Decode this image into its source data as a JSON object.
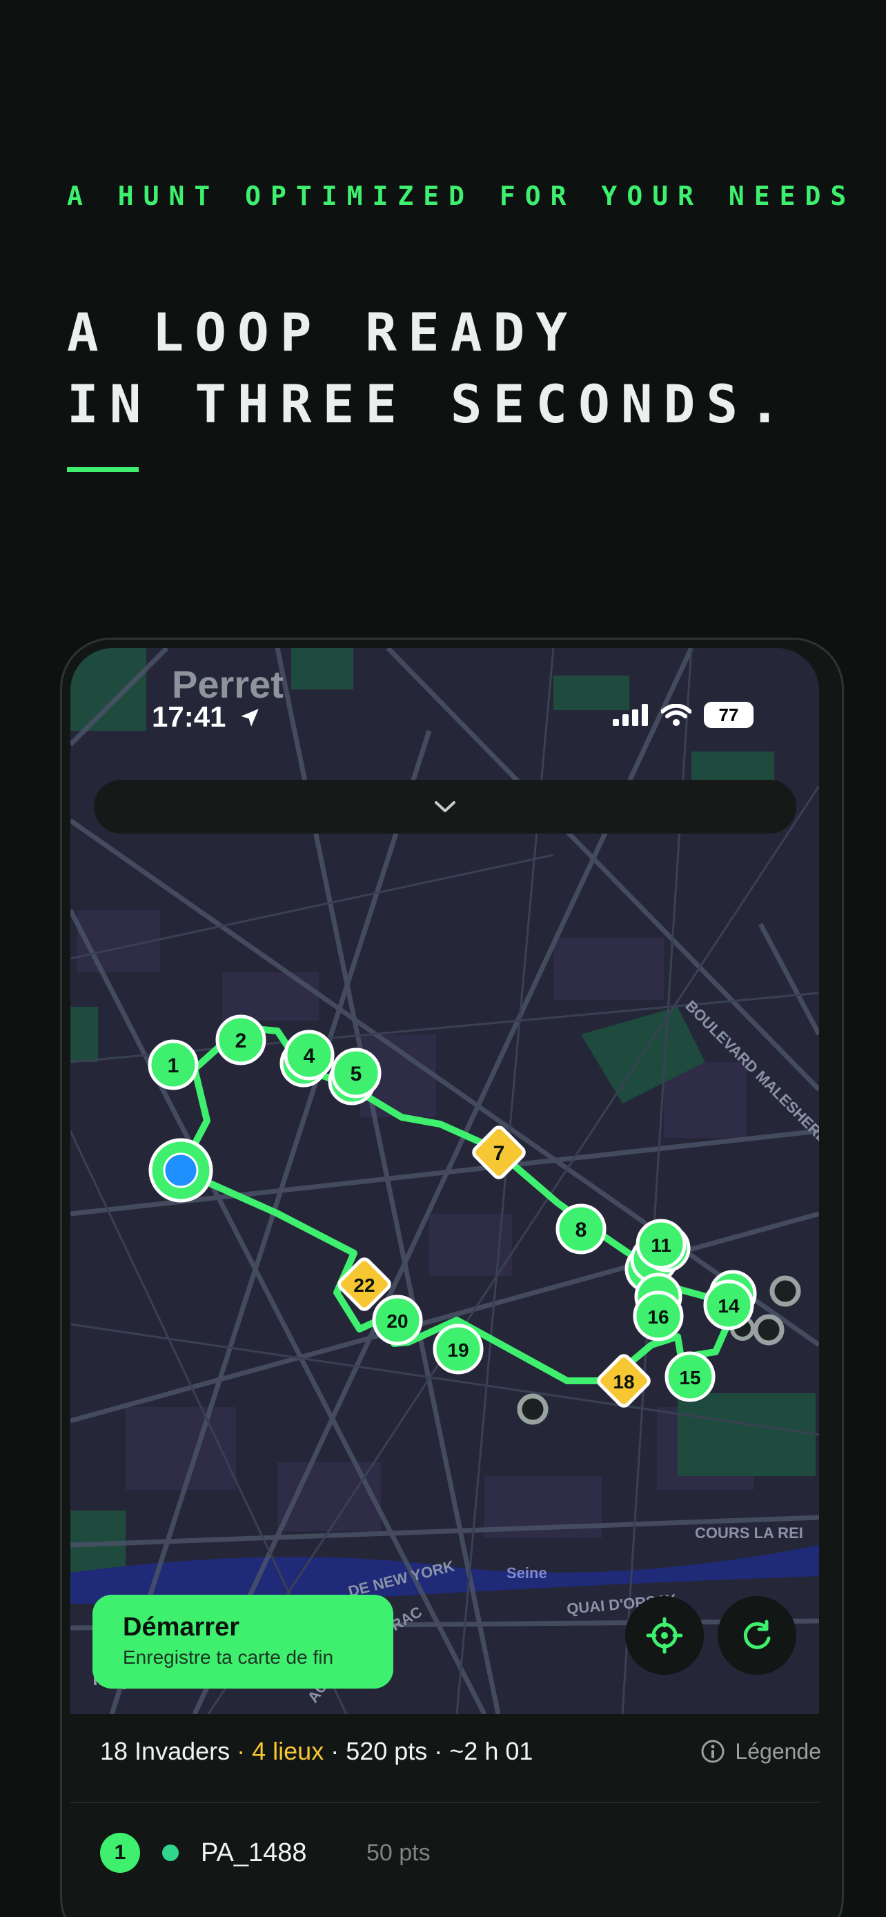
{
  "hero": {
    "kicker": "A HUNT OPTIMIZED FOR YOUR NEEDS",
    "headline_line1": "A LOOP READY",
    "headline_line2": "IN THREE SECONDS."
  },
  "status_bar": {
    "time": "17:41",
    "battery": "77"
  },
  "map": {
    "city_label": "Perret",
    "street_labels": [
      "BOULEVARD MALESHERBES",
      "COURS LA REI",
      "QUAI D'ORSAY",
      "Seine",
      "DE NEW YORK",
      "RAC",
      "ACO"
    ],
    "markers": [
      {
        "label": "1",
        "kind": "invader"
      },
      {
        "label": "2",
        "kind": "invader"
      },
      {
        "label": "4",
        "kind": "invader"
      },
      {
        "label": "5",
        "kind": "invader"
      },
      {
        "label": "7",
        "kind": "place"
      },
      {
        "label": "8",
        "kind": "invader"
      },
      {
        "label": "11",
        "kind": "invader"
      },
      {
        "label": "14",
        "kind": "invader"
      },
      {
        "label": "15",
        "kind": "invader"
      },
      {
        "label": "16",
        "kind": "invader"
      },
      {
        "label": "18",
        "kind": "place"
      },
      {
        "label": "19",
        "kind": "invader"
      },
      {
        "label": "20",
        "kind": "invader"
      },
      {
        "label": "22",
        "kind": "place"
      }
    ],
    "attribution": "Maps",
    "side_number": "16"
  },
  "start_button": {
    "title": "Démarrer",
    "subtitle": "Enregistre ta carte de fin"
  },
  "summary": {
    "invaders": "18 Invaders",
    "sep1": " · ",
    "places": "4 lieux",
    "sep2": " · ",
    "points": "520 pts",
    "sep3": " · ",
    "duration": "~2 h 01",
    "legend": "Légende"
  },
  "list": [
    {
      "index": "1",
      "name": "PA_1488",
      "points": "50 pts"
    }
  ],
  "colors": {
    "accent": "#3ff06f",
    "place": "#f7c733",
    "background": "#0d1211",
    "user_location": "#1e90ff"
  },
  "icons": {
    "location_arrow": "location-arrow-icon",
    "chevron": "chevron-down-icon",
    "recenter": "crosshair-icon",
    "refresh": "refresh-icon",
    "info": "info-icon"
  }
}
